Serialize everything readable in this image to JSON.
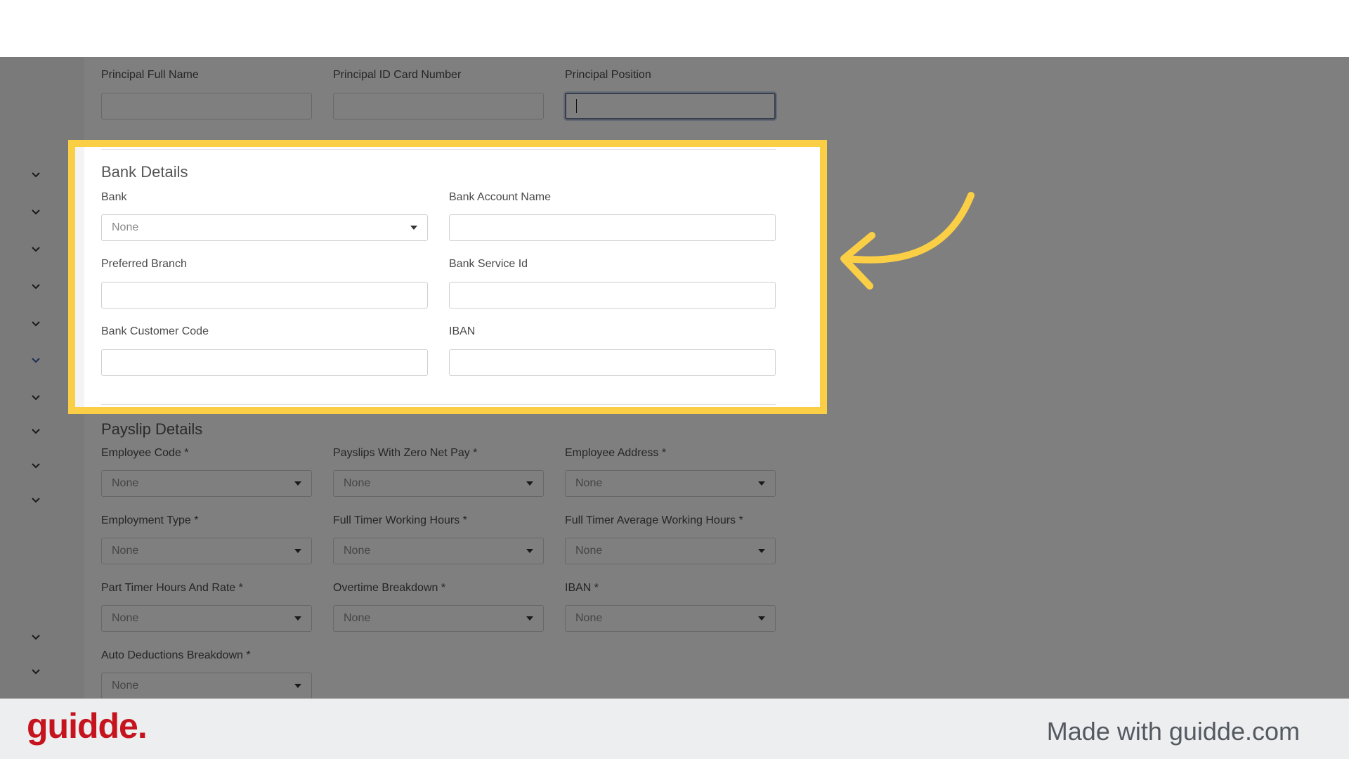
{
  "director_section": {
    "fields": [
      {
        "label": "Principal Full Name",
        "value": ""
      },
      {
        "label": "Principal ID Card Number",
        "value": ""
      },
      {
        "label": "Principal Position",
        "value": ""
      }
    ]
  },
  "bank_section": {
    "title": "Bank Details",
    "bank_label": "Bank",
    "bank_value": "None",
    "account_name_label": "Bank Account Name",
    "preferred_branch_label": "Preferred Branch",
    "service_id_label": "Bank Service Id",
    "customer_code_label": "Bank Customer Code",
    "iban_label": "IBAN"
  },
  "payslip_section": {
    "title": "Payslip Details",
    "fields": [
      {
        "label": "Employee Code *",
        "value": "None"
      },
      {
        "label": "Payslips With Zero Net Pay *",
        "value": "None"
      },
      {
        "label": "Employee Address *",
        "value": "None"
      },
      {
        "label": "Employment Type *",
        "value": "None"
      },
      {
        "label": "Full Timer Working Hours *",
        "value": "None"
      },
      {
        "label": "Full Timer Average Working Hours  *",
        "value": "None"
      },
      {
        "label": "Part Timer Hours And Rate *",
        "value": "None"
      },
      {
        "label": "Overtime Breakdown *",
        "value": "None"
      },
      {
        "label": "IBAN *",
        "value": "None"
      },
      {
        "label": "Auto Deductions Breakdown *",
        "value": "None"
      }
    ]
  },
  "sidebar": {
    "icon": "chevron-down-icon",
    "count": 12
  },
  "highlight_color": "#fbcf45",
  "dim_overlay_color": "#000000",
  "footer": {
    "logo_text": "guidde.",
    "made_with": "Made with guidde.com",
    "logo_color": "#c5141d"
  }
}
